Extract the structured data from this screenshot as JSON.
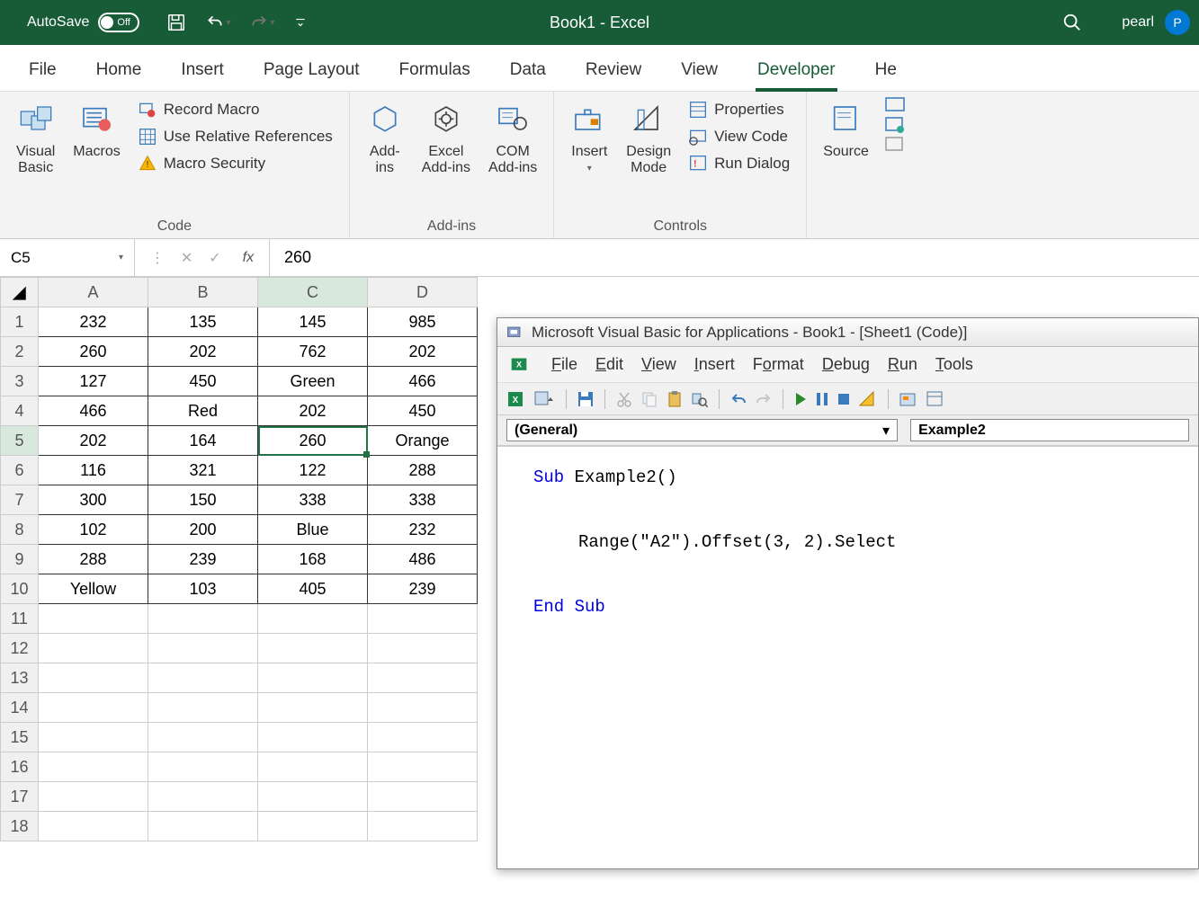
{
  "titlebar": {
    "autosave_label": "AutoSave",
    "autosave_state": "Off",
    "app_title": "Book1 - Excel",
    "user_name": "pearl",
    "user_initial": "P"
  },
  "menu": {
    "tabs": [
      "File",
      "Home",
      "Insert",
      "Page Layout",
      "Formulas",
      "Data",
      "Review",
      "View",
      "Developer",
      "He"
    ],
    "active_index": 8
  },
  "ribbon": {
    "code": {
      "label": "Code",
      "visual_basic": "Visual\nBasic",
      "macros": "Macros",
      "record_macro": "Record Macro",
      "use_relative": "Use Relative References",
      "macro_security": "Macro Security"
    },
    "addins": {
      "label": "Add-ins",
      "addins": "Add-\nins",
      "excel_addins": "Excel\nAdd-ins",
      "com_addins": "COM\nAdd-ins"
    },
    "controls": {
      "label": "Controls",
      "insert": "Insert",
      "design_mode": "Design\nMode",
      "properties": "Properties",
      "view_code": "View Code",
      "run_dialog": "Run Dialog"
    },
    "xml": {
      "source": "Source"
    }
  },
  "formula_bar": {
    "namebox": "C5",
    "value": "260"
  },
  "sheet": {
    "cols": [
      "A",
      "B",
      "C",
      "D"
    ],
    "rows": [
      "1",
      "2",
      "3",
      "4",
      "5",
      "6",
      "7",
      "8",
      "9",
      "10",
      "11",
      "12",
      "13",
      "14",
      "15",
      "16",
      "17",
      "18"
    ],
    "data": [
      [
        "232",
        "135",
        "145",
        "985"
      ],
      [
        "260",
        "202",
        "762",
        "202"
      ],
      [
        "127",
        "450",
        "Green",
        "466"
      ],
      [
        "466",
        "Red",
        "202",
        "450"
      ],
      [
        "202",
        "164",
        "260",
        "Orange"
      ],
      [
        "116",
        "321",
        "122",
        "288"
      ],
      [
        "300",
        "150",
        "338",
        "338"
      ],
      [
        "102",
        "200",
        "Blue",
        "232"
      ],
      [
        "288",
        "239",
        "168",
        "486"
      ],
      [
        "Yellow",
        "103",
        "405",
        "239"
      ]
    ],
    "selected": {
      "row": 5,
      "col": "C"
    }
  },
  "vba": {
    "title": "Microsoft Visual Basic for Applications - Book1 - [Sheet1 (Code)]",
    "menu": [
      "File",
      "Edit",
      "View",
      "Insert",
      "Format",
      "Debug",
      "Run",
      "Tools"
    ],
    "dd_left": "(General)",
    "dd_right": "Example2",
    "code_sub": "Sub",
    "code_name": " Example2()",
    "code_body": "Range(\"A2\").Offset(3, 2).Select",
    "code_end": "End Sub"
  }
}
